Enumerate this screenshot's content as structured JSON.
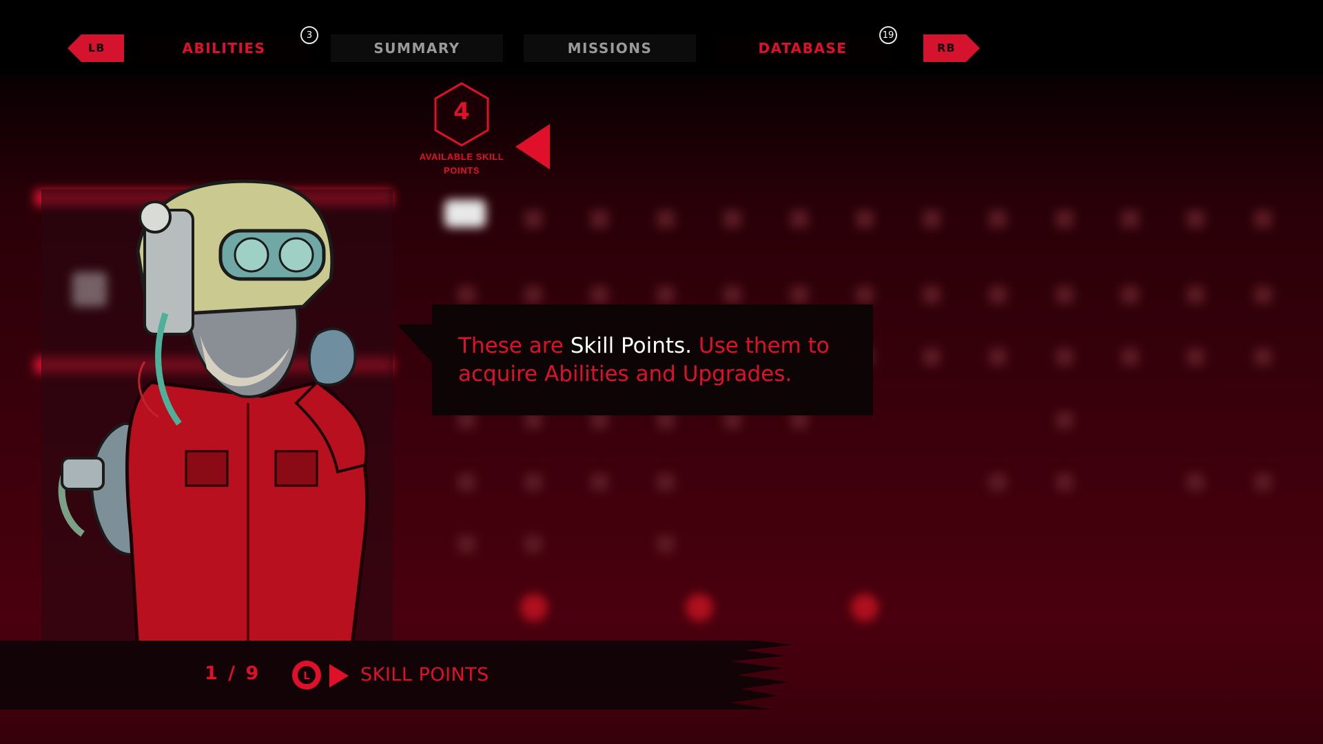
{
  "nav": {
    "left_bumper": "LB",
    "right_bumper": "RB",
    "tabs": [
      {
        "label": "ABILITIES",
        "badge": "3",
        "color": "#e0102a"
      },
      {
        "label": "SUMMARY",
        "color": "#9a9a9a"
      },
      {
        "label": "MISSIONS",
        "color": "#9a9a9a"
      },
      {
        "label": "DATABASE",
        "badge": "19",
        "color": "#e0102a"
      }
    ]
  },
  "skill_points": {
    "value": "4",
    "label": "AVAILABLE SKILL POINTS"
  },
  "tooltip": {
    "part1": "These are ",
    "highlight": "Skill Points.",
    "part2": " Use them to acquire Abilities and Upgrades."
  },
  "footer": {
    "page_counter": "1 / 9",
    "stick_glyph": "L",
    "topic": "SKILL POINTS"
  },
  "colors": {
    "accent": "#e0102a",
    "inactive_tab": "#9a9a9a",
    "highlight_text": "#ffffff",
    "background": "#3a000b"
  }
}
